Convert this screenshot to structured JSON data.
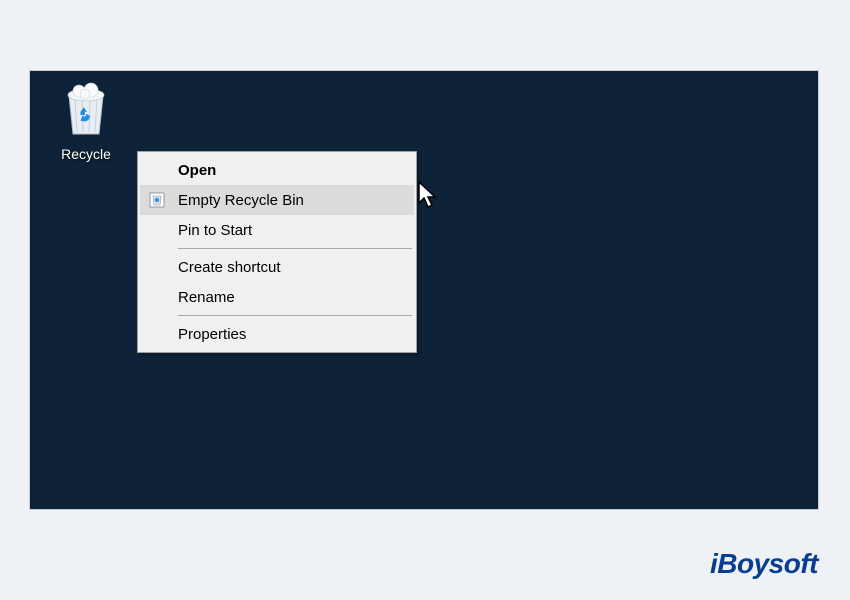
{
  "desktop": {
    "icon_label": "Recycle"
  },
  "context_menu": {
    "items": [
      {
        "label": "Open",
        "bold": true,
        "has_icon": false
      },
      {
        "label": "Empty Recycle Bin",
        "bold": false,
        "has_icon": true,
        "hover": true
      },
      {
        "label": "Pin to Start",
        "bold": false,
        "has_icon": false
      }
    ],
    "items_group2": [
      {
        "label": "Create shortcut"
      },
      {
        "label": "Rename"
      }
    ],
    "items_group3": [
      {
        "label": "Properties"
      }
    ]
  },
  "brand": {
    "text": "iBoysoft"
  }
}
